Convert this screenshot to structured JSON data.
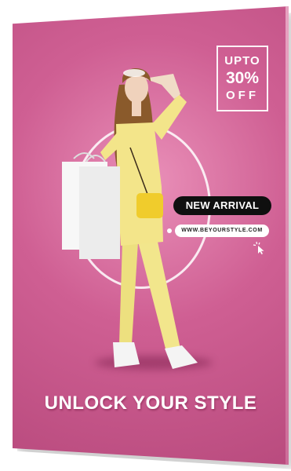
{
  "offer": {
    "line1": "UPTO",
    "line2": "30%",
    "line3": "OFF"
  },
  "badge": {
    "label": "NEW ARRIVAL"
  },
  "website": {
    "url": "WWW.BEYOURSTYLE.COM"
  },
  "headline": {
    "text": "UNLOCK YOUR STYLE"
  },
  "colors": {
    "poster_background": "#cf5f93",
    "outfit": "#f3e58a",
    "bag": "#f0cc2c",
    "pill_dark": "#0f0f0f",
    "text_light": "#ffffff"
  },
  "icons": {
    "cursor": "click-cursor-icon"
  }
}
